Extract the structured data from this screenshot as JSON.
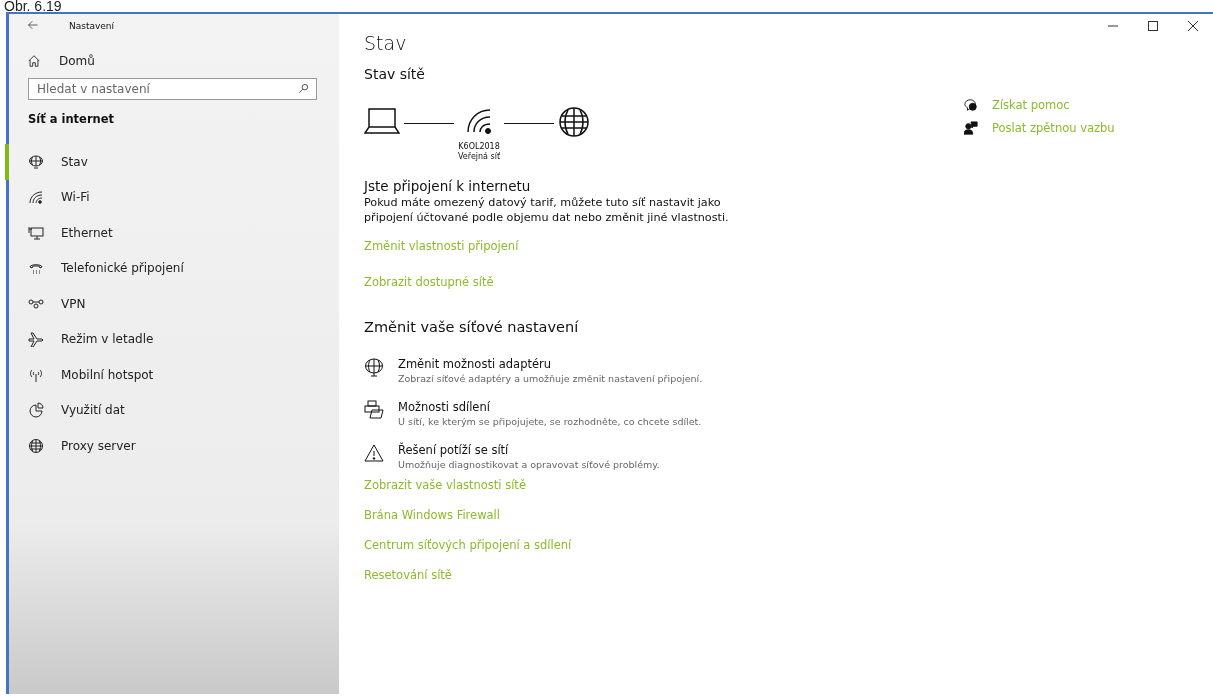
{
  "caption": "Obr. 6.19",
  "window": {
    "title": "Nastavení"
  },
  "sidebar": {
    "home": "Domů",
    "search": {
      "placeholder": "Hledat v nastavení"
    },
    "section": "Síť a internet",
    "items": [
      {
        "label": "Stav",
        "selected": true
      },
      {
        "label": "Wi-Fi",
        "selected": false
      },
      {
        "label": "Ethernet",
        "selected": false
      },
      {
        "label": "Telefonické připojení",
        "selected": false
      },
      {
        "label": "VPN",
        "selected": false
      },
      {
        "label": "Režim v letadle",
        "selected": false
      },
      {
        "label": "Mobilní hotspot",
        "selected": false
      },
      {
        "label": "Využití dat",
        "selected": false
      },
      {
        "label": "Proxy server",
        "selected": false
      }
    ]
  },
  "main": {
    "title": "Stav",
    "network_status": {
      "heading": "Stav sítě",
      "network_name": "K6OL2018",
      "network_type": "Veřejná síť"
    },
    "connected": {
      "heading": "Jste připojení k internetu",
      "text": "Pokud máte omezený datový tarif, můžete tuto síť nastavit jako připojení účtované podle objemu dat nebo změnit jiné vlastnosti."
    },
    "links_top": [
      "Změnit vlastnosti připojení",
      "Zobrazit dostupné sítě"
    ],
    "change_heading": "Změnit vaše síťové nastavení",
    "options": [
      {
        "title": "Změnit možnosti adaptéru",
        "description": "Zobrazí síťové adaptéry a umožňuje změnit nastavení připojení."
      },
      {
        "title": "Možnosti sdílení",
        "description": "U sítí, ke kterým se připojujete, se rozhodněte, co chcete sdílet."
      },
      {
        "title": "Řešení potíží se sítí",
        "description": "Umožňuje diagnostikovat a opravovat síťové problémy."
      }
    ],
    "links_bottom": [
      "Zobrazit vaše vlastnosti sítě",
      "Brána Windows Firewall",
      "Centrum síťových připojení a sdílení",
      "Resetování sítě"
    ]
  },
  "help": [
    "Získat pomoc",
    "Poslat zpětnou vazbu"
  ]
}
